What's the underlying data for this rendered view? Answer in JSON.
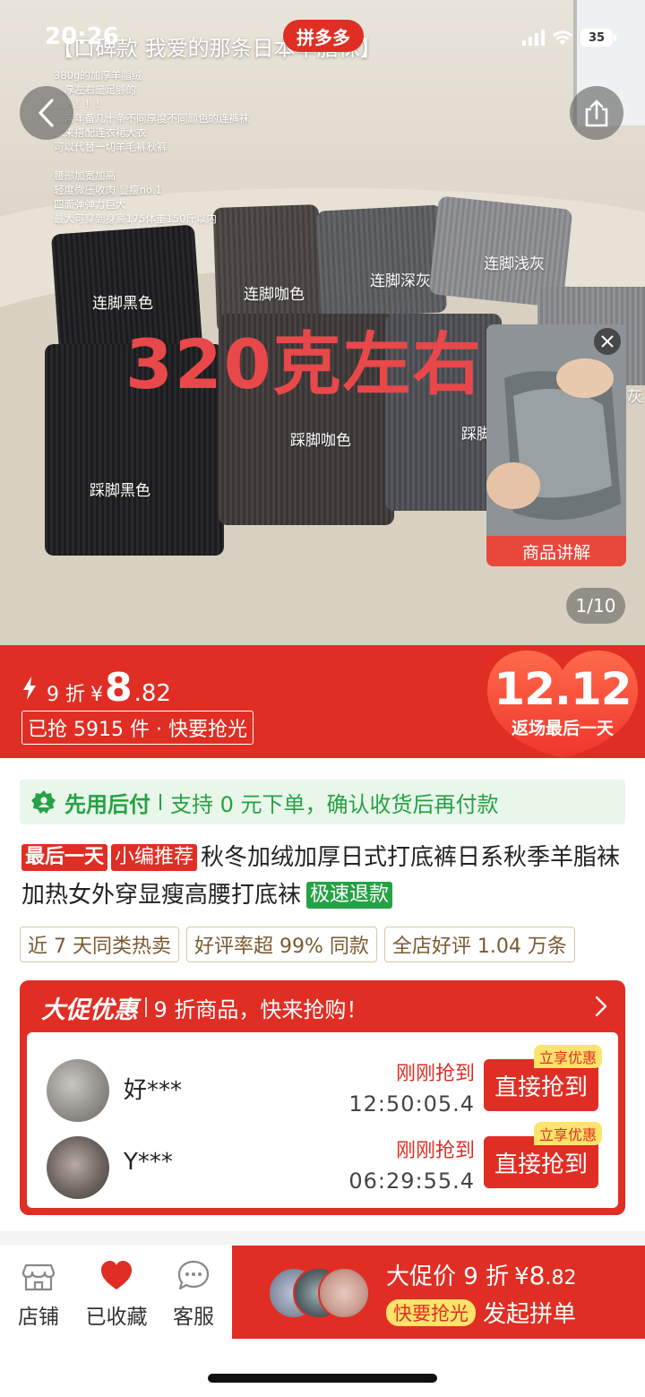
{
  "status": {
    "time": "20:26",
    "battery": "35"
  },
  "app_badge": "拼多多",
  "hero": {
    "top_text": "【口碑款 我爱的那条日本羊脂袜】",
    "notes": "380g的加厚羊脂绒\n…厚左右是足够的\n…入！！！\n…常年备几十条不同厚度不同颜色的连裤袜\n…来搭配连衣裙大衣\n可以代替一切羊毛裤秋裤\n\n腰部加宽加高\n轻度微压收肉 显瘦no.1\n四面弹弹力巨大\n最大可穿到身高175体重150斤以内",
    "big_text": "320克左右",
    "labels": {
      "black_footed": "连脚黑色",
      "coffee_footed": "连脚咖色",
      "deepgray_footed": "连脚深灰",
      "lightgray_footed": "连脚浅灰",
      "black_stirrup": "踩脚黑色",
      "coffee_stirrup": "踩脚咖色",
      "partial_stirrup": "踩脚",
      "partial_gray": "灰"
    },
    "video_caption": "商品讲解",
    "page_indicator": "1/10"
  },
  "price": {
    "discount": "9 折",
    "yen": "¥",
    "int": "8",
    "dec": ".82",
    "sold": "已抢 5915 件 · 快要抢光",
    "badge_big": "12.12",
    "badge_small": "返场最后一天"
  },
  "paylater": {
    "t1": "先用后付",
    "t2": "支持 0 元下单，确认收货后再付款"
  },
  "title": {
    "tag1": "最后一天",
    "tag2": "小编推荐",
    "text": "秋冬加绒加厚日式打底裤日系秋季羊脂袜加热女外穿显瘦高腰打底袜",
    "tag3": "极速退款"
  },
  "chips": [
    "近 7 天同类热卖",
    "好评率超 99% 同款",
    "全店好评 1.04 万条"
  ],
  "promo": {
    "head_bold": "大促优惠",
    "head_text": "9 折商品，快来抢购！",
    "buyers": [
      {
        "name": "好***",
        "got": "刚刚抢到",
        "time": "12:50:05.4",
        "button": "直接抢到",
        "share": "立享优惠"
      },
      {
        "name": "Y***",
        "got": "刚刚抢到",
        "time": "06:29:55.4",
        "button": "直接抢到",
        "share": "立享优惠"
      }
    ]
  },
  "bottom": {
    "store": "店铺",
    "favorited": "已收藏",
    "service": "客服",
    "buy_label": "大促价 9 折",
    "buy_yen": "¥",
    "buy_int": "8",
    "buy_dec": ".82",
    "hurry": "快要抢光",
    "start_group": "发起拼单"
  }
}
